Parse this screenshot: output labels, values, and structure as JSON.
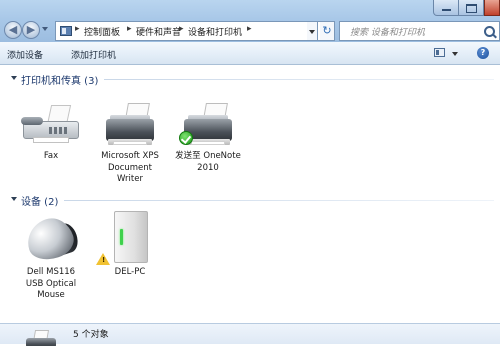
{
  "breadcrumb": [
    "控制面板",
    "硬件和声音",
    "设备和打印机"
  ],
  "search": {
    "placeholder": "搜索 设备和打印机"
  },
  "toolbar": {
    "add_device": "添加设备",
    "add_printer": "添加打印机",
    "help_label": "?"
  },
  "groups": [
    {
      "title": "打印机和传真 (3)",
      "items": [
        {
          "lines": [
            "Fax"
          ],
          "icon": "fax-icon"
        },
        {
          "lines": [
            "Microsoft XPS",
            "Document",
            "Writer"
          ],
          "icon": "printer-icon"
        },
        {
          "lines": [
            "发送至 OneNote",
            "2010"
          ],
          "icon": "printer-icon",
          "badge": "default-checkmark-icon"
        }
      ]
    },
    {
      "title": "设备 (2)",
      "items": [
        {
          "lines": [
            "Dell MS116",
            "USB Optical",
            "Mouse"
          ],
          "icon": "mouse-icon"
        },
        {
          "lines": [
            "DEL-PC"
          ],
          "icon": "computer-icon",
          "badge": "warning-icon"
        }
      ]
    }
  ],
  "details": {
    "count_text": "5 个对象"
  }
}
